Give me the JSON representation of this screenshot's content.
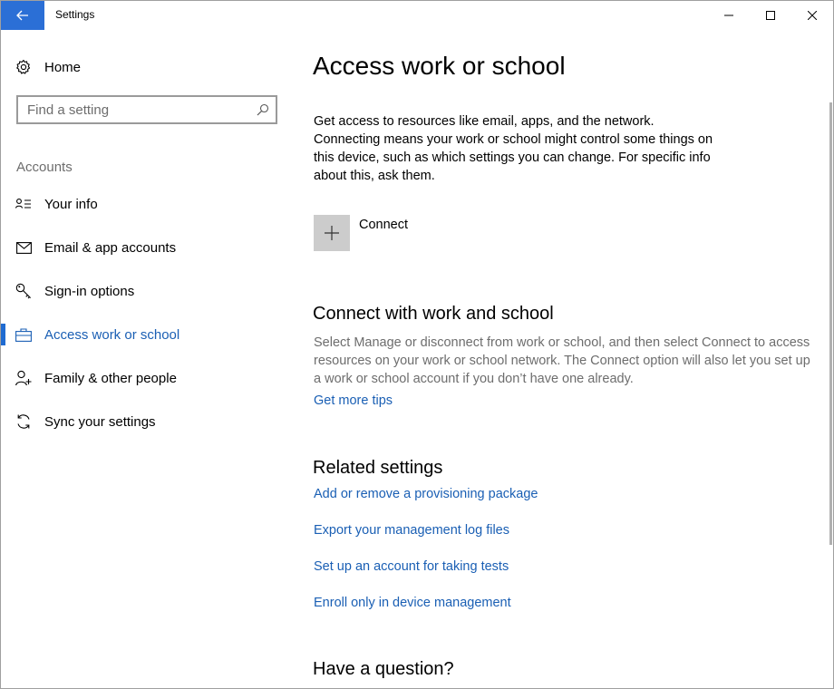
{
  "window": {
    "title": "Settings",
    "accent": "#2b6fd6"
  },
  "sidebar": {
    "home_label": "Home",
    "search_placeholder": "Find a setting",
    "section_label": "Accounts",
    "items": [
      {
        "label": "Your info",
        "icon": "contact-card-icon",
        "active": false
      },
      {
        "label": "Email & app accounts",
        "icon": "mail-icon",
        "active": false
      },
      {
        "label": "Sign-in options",
        "icon": "key-icon",
        "active": false
      },
      {
        "label": "Access work or school",
        "icon": "briefcase-icon",
        "active": true
      },
      {
        "label": "Family & other people",
        "icon": "add-person-icon",
        "active": false
      },
      {
        "label": "Sync your settings",
        "icon": "sync-icon",
        "active": false
      }
    ]
  },
  "main": {
    "title": "Access work or school",
    "intro": "Get access to resources like email, apps, and the network. Connecting means your work or school might control some things on this device, such as which settings you can change. For specific info about this, ask them.",
    "connect_label": "Connect",
    "connect_section": {
      "heading": "Connect with work and school",
      "body": "Select Manage or disconnect from work or school, and then select Connect to access resources on your work or school network. The Connect option will also let you set up a work or school account if you don’t have one already.",
      "tips_link": "Get more tips"
    },
    "related": {
      "heading": "Related settings",
      "links": [
        "Add or remove a provisioning package",
        "Export your management log files",
        "Set up an account for taking tests",
        "Enroll only in device management"
      ]
    },
    "question_heading": "Have a question?"
  }
}
